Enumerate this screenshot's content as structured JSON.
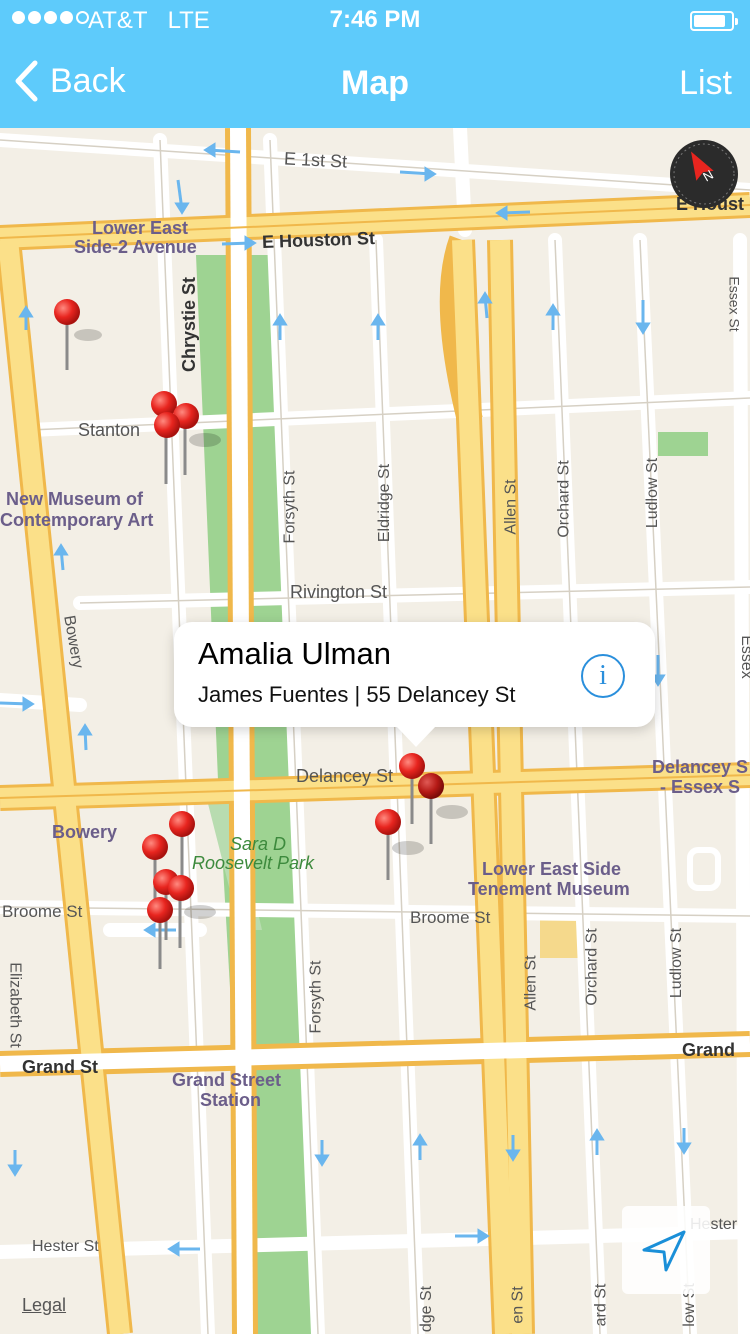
{
  "status_bar": {
    "carrier": "AT&T",
    "network": "LTE",
    "time": "7:46 PM",
    "battery_level": 0.85
  },
  "nav": {
    "back_label": "Back",
    "title": "Map",
    "list_label": "List"
  },
  "callout": {
    "title": "Amalia Ulman",
    "subtitle": "James Fuentes | 55 Delancey St",
    "info_glyph": "i"
  },
  "legal_label": "Legal",
  "map_labels": {
    "e_1st_st": "E 1st St",
    "lower_east_side_2_avenue_line1": "Lower East",
    "lower_east_side_2_avenue_line2": "Side-2 Avenue",
    "e_houston_st": "E Houston St",
    "e_houston_right": "E Houst",
    "chrystie_st": "Chrystie St",
    "essex_st_top": "Essex St",
    "stanton": "Stanton",
    "new_museum_line1": "New Museum of",
    "new_museum_line2": "Contemporary Art",
    "forsyth_st": "Forsyth St",
    "eldridge_st": "Eldridge St",
    "allen_st": "Allen St",
    "orchard_st": "Orchard St",
    "ludlow_st": "Ludlow St",
    "rivington_st": "Rivington St",
    "bowery_street": "Bowery",
    "delancey_st": "Delancey St",
    "delancey_essex_line1": "Delancey S",
    "delancey_essex_line2": "- Essex S",
    "bowery_station": "Bowery",
    "sara_d_line1": "Sara D",
    "sara_d_line2": "Roosevelt Park",
    "tenement_line1": "Lower East Side",
    "tenement_line2": "Tenement Museum",
    "broome_st_left": "Broome St",
    "broome_st_mid": "Broome St",
    "elizabeth_st": "Elizabeth St",
    "forsyth_st_lower": "Forsyth St",
    "allen_st_lower": "Allen St",
    "orchard_st_lower": "Orchard St",
    "ludlow_st_lower": "Ludlow St",
    "grand_st_left": "Grand St",
    "grand_st_right": "Grand",
    "grand_street_station_line1": "Grand Street",
    "grand_street_station_line2": "Station",
    "hester_st": "Hester St",
    "hester_right": "Hester",
    "eldridge_bottom": "dge St",
    "allen_bottom": "en St",
    "orchard_bottom": "ard St",
    "ludlow_bottom": "low St",
    "essex_partial": "Essex"
  },
  "icons": {
    "back": "chevron-left-icon",
    "compass": "compass-icon",
    "locate": "location-arrow-icon",
    "info": "info-icon",
    "pin": "map-pin-icon"
  },
  "colors": {
    "header": "#5ecbfb",
    "pin": "#e8251f",
    "park": "#9ed392",
    "major_road": "#fbe089",
    "road_edge": "#f0b84b",
    "one_way_arrow": "#6ab6ee",
    "info": "#2a8fdc"
  }
}
